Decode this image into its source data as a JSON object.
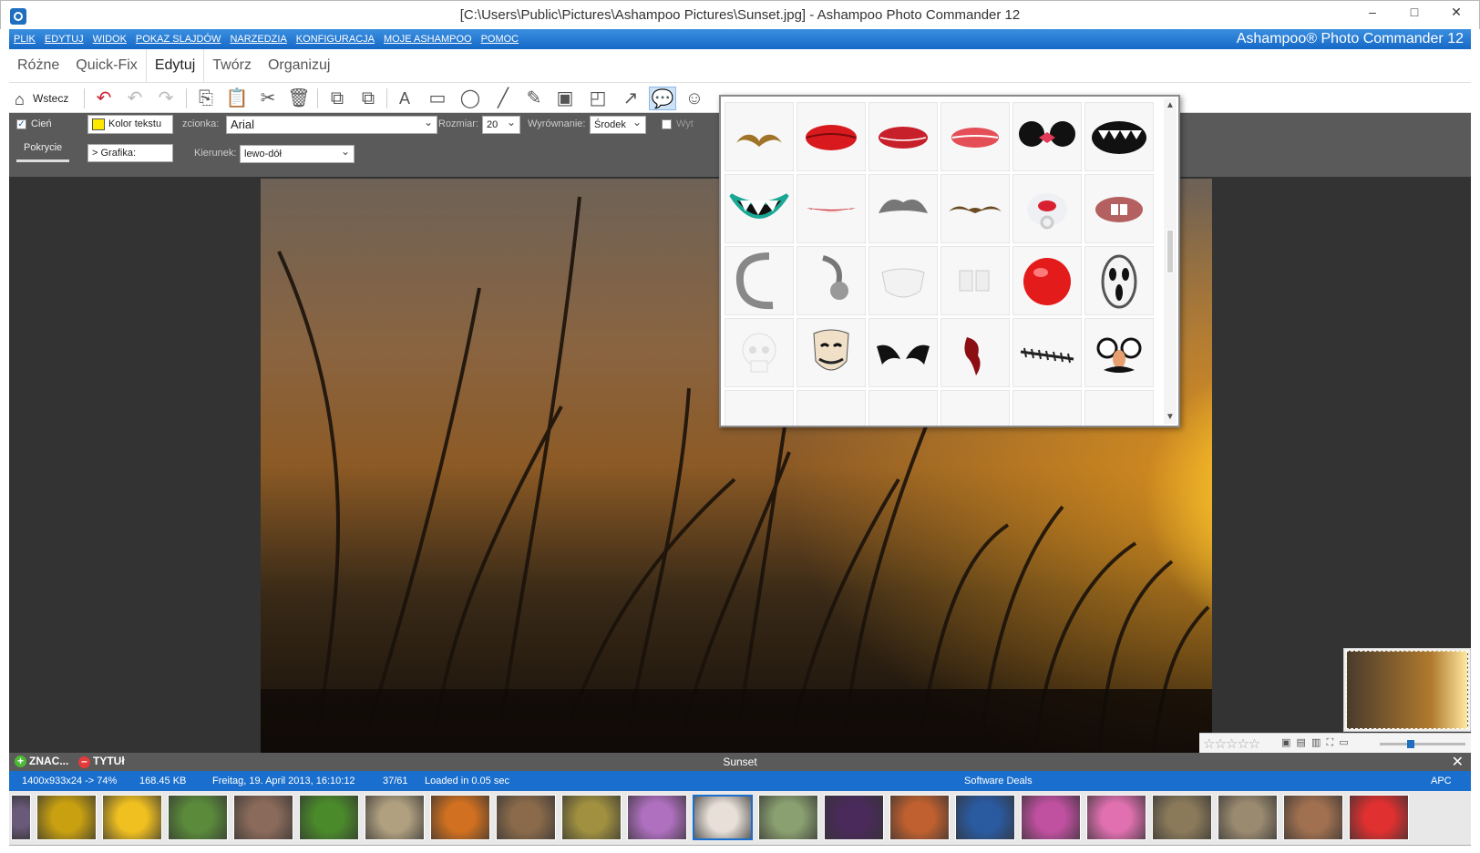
{
  "window": {
    "title": "[C:\\Users\\Public\\Pictures\\Ashampoo Pictures\\Sunset.jpg] - Ashampoo Photo Commander 12",
    "min_glyph": "–",
    "max_glyph": "□",
    "close_glyph": "✕"
  },
  "menu": {
    "items": [
      "PLIK",
      "EDYTUJ",
      "WIDOK",
      "POKAZ SLAJDÓW",
      "NARZEDZIA",
      "KONFIGURACJA",
      "MOJE ASHAMPOO",
      "POMOC"
    ],
    "brand": "Ashampoo® Photo Commander 12"
  },
  "tabs": [
    "Różne",
    "Quick-Fix",
    "Edytuj",
    "Twórz",
    "Organizuj"
  ],
  "toolbar": {
    "back_label": "Wstecz"
  },
  "options": {
    "shadow_label": "Cień",
    "text_color_label": "Kolor tekstu",
    "font_label": "zcionka:",
    "font_value": "Arial",
    "size_label": "Rozmiar:",
    "size_value": "20",
    "align_label": "Wyrównanie:",
    "align_value": "Środek",
    "wyt_label": "Wyt",
    "opacity_label": "Pokrycie",
    "graphic_label": "Grafika:",
    "direction_label": "Kierunek:",
    "direction_value": "lewo-dół",
    "accent_yellow": "#ffe800"
  },
  "stickers": [
    "mustache-curly",
    "lips-red",
    "lips-kiss",
    "lips-print",
    "mouse-ears-bow",
    "vampire-mouth",
    "monster-mouth",
    "thin-smile",
    "gray-mustache",
    "thin-mustache",
    "baby-pacifier",
    "buck-teeth",
    "earring-c",
    "earring-ball",
    "face-mask",
    "cups",
    "clown-nose",
    "scream-mask",
    "skull",
    "guy-fawkes-mask",
    "bat-wings",
    "blood-wound",
    "stitches",
    "groucho-glasses"
  ],
  "bottom": {
    "tag_label": "ZNAC...",
    "title_label": "TYTUł",
    "image_name": "Sunset",
    "close_glyph": "✕",
    "dimensions": "1400x933x24 -> 74%",
    "filesize": "168.45 KB",
    "date": "Freitag, 19. April 2013, 16:10:12",
    "position": "37/61",
    "load_time": "Loaded in 0.05 sec",
    "deals": "Software Deals",
    "apc": "APC",
    "rating_stars": "☆☆☆☆☆"
  },
  "filmstrip_colors": [
    "#6a5a7a",
    "#c8a010",
    "#f0c020",
    "#5a8a3a",
    "#8a6a5a",
    "#4a8a2a",
    "#b0a080",
    "#d07020",
    "#8a6a4a",
    "#a09040",
    "#b070c0",
    "#e8e0d8",
    "#8aa070",
    "#4a2a5a",
    "#c06030",
    "#2a5aa0",
    "#c050a0",
    "#e070b0",
    "#8a7a5a",
    "#9a8a70",
    "#a07050",
    "#e03030"
  ]
}
